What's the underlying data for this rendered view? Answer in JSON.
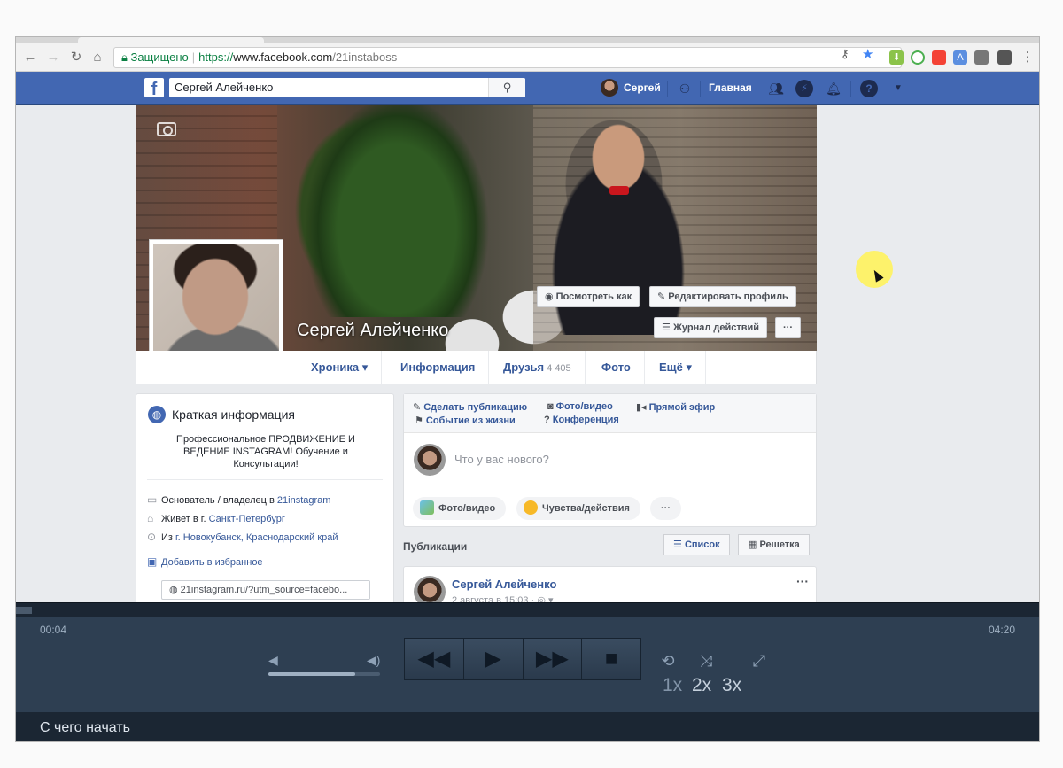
{
  "browser": {
    "secure_label": "Защищено",
    "url_scheme": "https://",
    "url_host": "www.facebook.com",
    "url_path": "/21instaboss"
  },
  "fb_header": {
    "search_value": "Сергей Алейченко",
    "user_name": "Сергей",
    "home_label": "Главная",
    "brand_color": "#4267b2"
  },
  "profile": {
    "name": "Сергей Алейченко",
    "view_as_label": "Посмотреть как",
    "edit_profile_label": "Редактировать профиль",
    "activity_log_label": "Журнал действий",
    "more_label": "···"
  },
  "tabs": [
    {
      "label": "Хроника ▾"
    },
    {
      "label": "Информация"
    },
    {
      "label": "Друзья",
      "count": "4 405"
    },
    {
      "label": "Фото"
    },
    {
      "label": "Ещё ▾"
    }
  ],
  "intro": {
    "title": "Краткая информация",
    "bio": "Профессиональное ПРОДВИЖЕНИЕ И ВЕДЕНИЕ INSTAGRAM! Обучение и Консультации!",
    "work_prefix": "Основатель / владелец в ",
    "work_link": "21instagram",
    "lives_prefix": "Живет в г. ",
    "lives_link": "Санкт-Петербург",
    "from_prefix": "Из ",
    "from_link": "г. Новокубанск, Краснодарский край",
    "add_featured": "Добавить в избранное",
    "website": "21instagram.ru/?utm_source=facebo..."
  },
  "composer": {
    "make_post": "Сделать публикацию",
    "photo_video": "Фото/видео",
    "live": "Прямой эфир",
    "life_event": "Событие из жизни",
    "conference": "Конференция",
    "placeholder": "Что у вас нового?",
    "pill_photo": "Фото/видео",
    "pill_feeling": "Чувства/действия",
    "pill_more": "···"
  },
  "publications": {
    "label": "Публикации",
    "list_label": "Список",
    "grid_label": "Решетка"
  },
  "post": {
    "author": "Сергей Алейченко",
    "date": "2 августа в 15:03 · ◎ ▾",
    "more": "···"
  },
  "player": {
    "time_current": "00:04",
    "time_total": "04:20",
    "volume_fraction": 0.78,
    "speed_1": "1x",
    "speed_2": "2x",
    "speed_3": "3x",
    "caption": "С чего начать"
  }
}
